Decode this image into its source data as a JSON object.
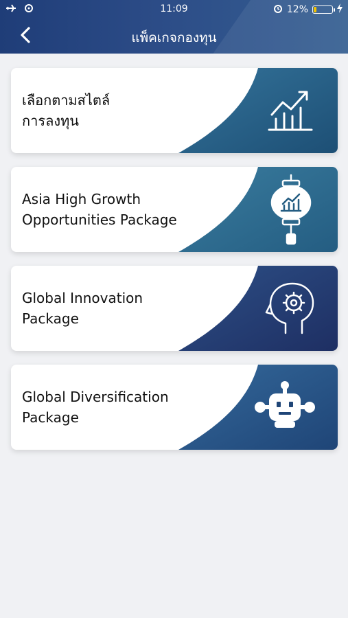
{
  "status_bar": {
    "time": "11:09",
    "battery_percent": "12%",
    "icons": [
      "airplane-icon",
      "wifi-icon",
      "alarm-icon",
      "battery-icon",
      "charging-icon"
    ]
  },
  "header": {
    "title": "แพ็คเกจกองทุน",
    "back_icon": "chevron-left-icon"
  },
  "cards": [
    {
      "label": "เลือกตามสไตล์\nการลงทุน",
      "icon": "bar-chart-trend-icon",
      "gradient": [
        "#34739a",
        "#1d4f75"
      ]
    },
    {
      "label": "Asia High Growth\nOpportunities Package",
      "icon": "lantern-chart-icon",
      "gradient": [
        "#3a7c9e",
        "#245d82"
      ]
    },
    {
      "label": "Global Innovation\nPackage",
      "icon": "head-gear-icon",
      "gradient": [
        "#2d4f86",
        "#1e2f63"
      ]
    },
    {
      "label": "Global Diversification\nPackage",
      "icon": "robot-icon",
      "gradient": [
        "#34689a",
        "#1f4577"
      ]
    }
  ]
}
